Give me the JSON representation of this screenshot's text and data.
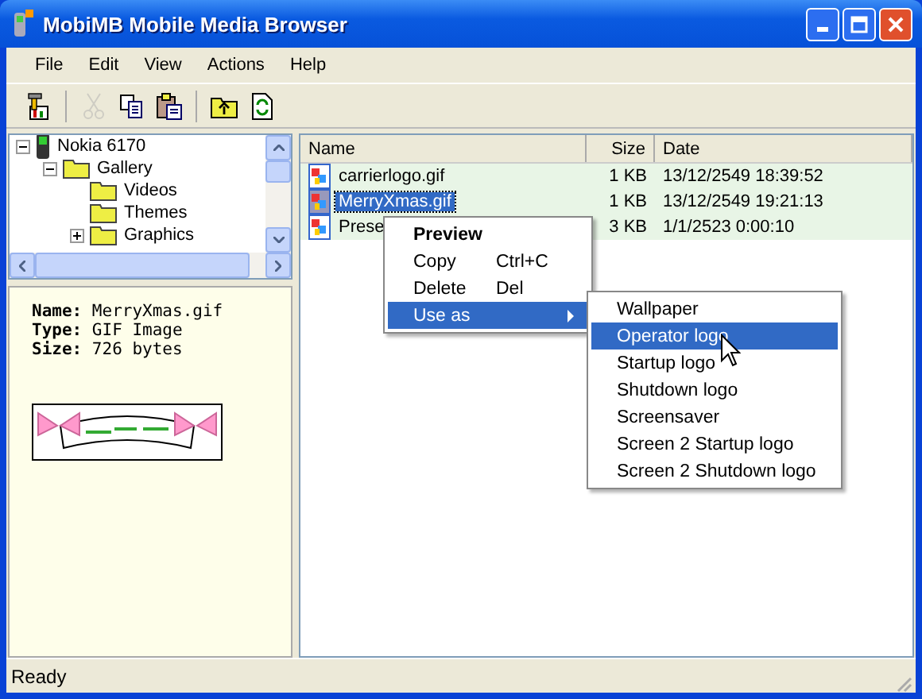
{
  "window": {
    "title": "MobiMB Mobile Media Browser"
  },
  "menu_bar": [
    "File",
    "Edit",
    "View",
    "Actions",
    "Help"
  ],
  "toolbar": [
    {
      "kind": "properties",
      "disabled": false
    },
    {
      "kind": "cut",
      "disabled": true
    },
    {
      "kind": "copy",
      "disabled": false
    },
    {
      "kind": "paste",
      "disabled": false
    },
    {
      "kind": "folder-up",
      "disabled": false
    },
    {
      "kind": "refresh",
      "disabled": false
    }
  ],
  "tree": [
    {
      "label": "Nokia 6170",
      "kind": "phone",
      "expanded": true,
      "children": [
        {
          "label": "Gallery",
          "kind": "folder",
          "expanded": true,
          "children": [
            {
              "label": "Videos",
              "kind": "folder"
            },
            {
              "label": "Themes",
              "kind": "folder"
            },
            {
              "label": "Graphics",
              "kind": "folder",
              "expanded": false
            }
          ]
        }
      ]
    }
  ],
  "info": {
    "lines": [
      "**Name:** MerryXmas.gif",
      "**Type:** GIF Image",
      "**Size:** 726 bytes"
    ]
  },
  "file_list": {
    "columns": [
      "Name",
      "Size",
      "Date"
    ],
    "rows": [
      {
        "name": "carrierlogo.gif",
        "size": "1 KB",
        "date": "13/12/2549 18:39:52",
        "selected": false
      },
      {
        "name": "MerryXmas.gif",
        "size": "1 KB",
        "date": "13/12/2549 19:21:13",
        "selected": true
      },
      {
        "name": "Prese",
        "size": "3 KB",
        "date": "1/1/2523 0:00:10",
        "selected": false
      }
    ]
  },
  "context_menu": [
    {
      "label": "Preview",
      "default": true,
      "selected": false
    },
    {
      "label": "Copy",
      "shortcut": "Ctrl+C",
      "default": false,
      "selected": false
    },
    {
      "label": "Delete",
      "shortcut": "Del",
      "default": false,
      "selected": false
    },
    {
      "label": "Use as",
      "submenu": true,
      "default": false,
      "selected": true
    }
  ],
  "submenu": [
    {
      "label": "Wallpaper",
      "selected": false
    },
    {
      "label": "Operator logo",
      "selected": true
    },
    {
      "label": "Startup logo",
      "selected": false
    },
    {
      "label": "Shutdown logo",
      "selected": false
    },
    {
      "label": "Screensaver",
      "selected": false
    },
    {
      "label": "Screen 2 Startup logo",
      "selected": false
    },
    {
      "label": "Screen 2 Shutdown logo",
      "selected": false
    }
  ],
  "status_bar": {
    "text": "Ready"
  }
}
